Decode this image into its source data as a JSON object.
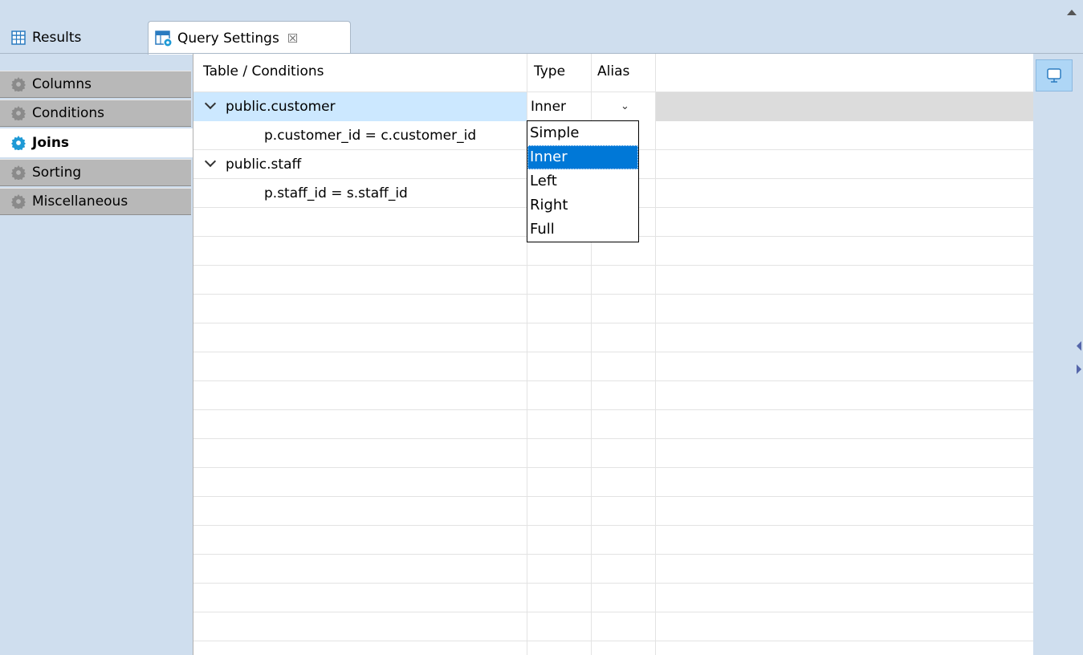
{
  "tabs": {
    "results_label": "Results",
    "query_settings_label": "Query Settings",
    "close_glyph": "☒"
  },
  "nav": {
    "items": [
      {
        "label": "Columns",
        "active": false
      },
      {
        "label": "Conditions",
        "active": false
      },
      {
        "label": "Joins",
        "active": true
      },
      {
        "label": "Sorting",
        "active": false
      },
      {
        "label": "Miscellaneous",
        "active": false
      }
    ]
  },
  "grid": {
    "headers": {
      "table": "Table / Conditions",
      "type": "Type",
      "alias": "Alias"
    },
    "rows": [
      {
        "level": 0,
        "text": "public.customer",
        "type": "Inner",
        "selected": true
      },
      {
        "level": 1,
        "text": "p.customer_id = c.customer_id"
      },
      {
        "level": 0,
        "text": "public.staff"
      },
      {
        "level": 1,
        "text": "p.staff_id = s.staff_id"
      }
    ]
  },
  "dropdown": {
    "options": [
      "Simple",
      "Inner",
      "Left",
      "Right",
      "Full"
    ],
    "highlighted": "Inner"
  },
  "icons": {
    "results": "table-grid-icon",
    "query_settings": "query-settings-icon",
    "nav": "gear-icon",
    "right_button": "presentation-icon"
  },
  "colors": {
    "accent": "#0078d7",
    "selected_row": "#cce8ff",
    "active_gear": "#1e9ad6",
    "inactive_gear": "#8a8a8a"
  }
}
